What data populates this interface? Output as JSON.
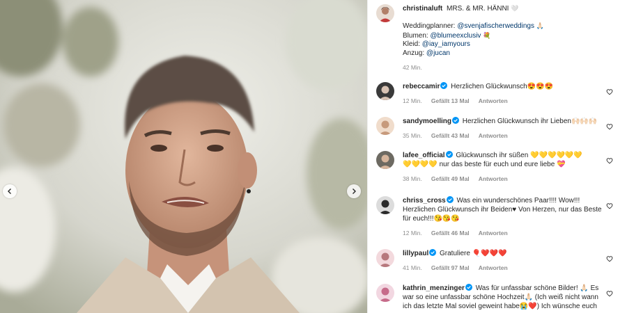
{
  "post": {
    "author": "christinaluft",
    "caption_title": "MRS. & MR. HÄNNI",
    "caption_title_emoji": "🤍",
    "caption_lines": [
      {
        "label": "Weddingplanner: ",
        "mention": "@svenjafischerweddings",
        "emoji": "🙏🏻"
      },
      {
        "label": "Blumen: ",
        "mention": "@blumeexclusiv",
        "emoji": "💐"
      },
      {
        "label": "Kleid: ",
        "mention": "@iay_iamyours",
        "emoji": ""
      },
      {
        "label": "Anzug: ",
        "mention": "@jucan",
        "emoji": ""
      }
    ],
    "time": "42 Min."
  },
  "comments": [
    {
      "user": "rebeccamir",
      "verified": true,
      "lines": [
        "Herzlichen Glückwunsch😍😍😍"
      ],
      "time": "12 Min.",
      "likes": "Gefällt 13 Mal",
      "reply": "Antworten"
    },
    {
      "user": "sandymoelling",
      "verified": true,
      "lines": [
        "Herzlichen Glückwunsch ihr Lieben🙌🏻🙌🏻🙌🏻"
      ],
      "time": "35 Min.",
      "likes": "Gefällt 43 Mal",
      "reply": "Antworten"
    },
    {
      "user": "lafee_official",
      "verified": true,
      "lines": [
        "Glückwunsch ihr süßen 💛💛💛💛💛💛",
        "💛💛💛💛 nur das beste für euch und eure liebe 💝"
      ],
      "time": "38 Min.",
      "likes": "Gefällt 49 Mal",
      "reply": "Antworten"
    },
    {
      "user": "chriss_cross",
      "verified": true,
      "lines": [
        "Was ein wunderschönes Paar!!!! Wow!!!",
        "Herzlichen Glückwunsch ihr Beiden♥ Von Herzen, nur das Beste",
        "für euch!!!😘😘😘"
      ],
      "time": "12 Min.",
      "likes": "Gefällt 46 Mal",
      "reply": "Antworten"
    },
    {
      "user": "lillypaul",
      "verified": true,
      "lines": [
        "Gratuliere 🎈❤️❤️❤️"
      ],
      "time": "41 Min.",
      "likes": "Gefällt 97 Mal",
      "reply": "Antworten"
    },
    {
      "user": "kathrin_menzinger",
      "verified": true,
      "lines": [
        "Was für unfassbar schöne Bilder! 🙏🏻 Es",
        "war so eine unfassbar schöne Hochzeit🙏🏻 (Ich weiß nicht wann",
        "ich das letzte Mal soviel geweint habe😭❤️) Ich wünsche euch"
      ],
      "time": "",
      "likes": "",
      "reply": ""
    }
  ],
  "colors": {
    "verified": "#0095f6",
    "mention": "#00376b",
    "meta": "#8e8e8e"
  },
  "icons": {
    "nav_prev": "chevron-left-icon",
    "nav_next": "chevron-right-icon",
    "like": "heart-icon",
    "verified": "verified-badge-icon"
  }
}
